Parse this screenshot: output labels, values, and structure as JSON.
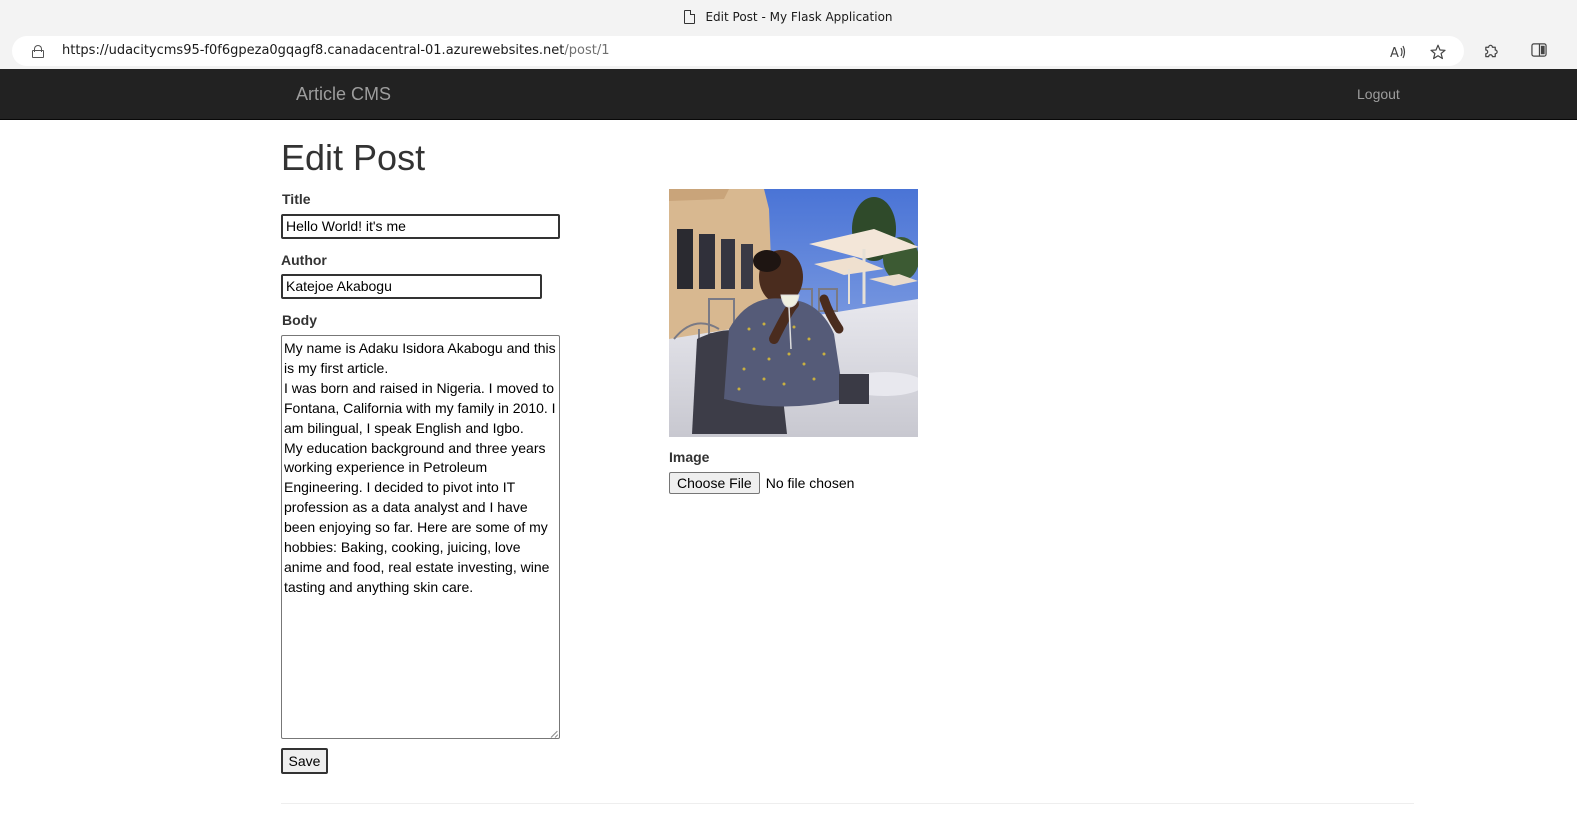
{
  "browser": {
    "tab_title": "Edit Post - My Flask Application",
    "url_host": "https://udacitycms95-f0f6gpeza0gqagf8.canadacentral-01.azurewebsites.net",
    "url_path": "/post/1"
  },
  "navbar": {
    "brand": "Article CMS",
    "logout": "Logout"
  },
  "form": {
    "heading": "Edit Post",
    "title_label": "Title",
    "title_value": "Hello World! it's me",
    "author_label": "Author",
    "author_value": "Katejoe Akabogu",
    "body_label": "Body",
    "body_value": "My name is Adaku Isidora Akabogu and this is my first article.\nI was born and raised in Nigeria. I moved to Fontana, California with my family in 2010. I am bilingual, I speak English and Igbo.\nMy education background and three years working experience in Petroleum Engineering. I decided to pivot into IT profession as a data analyst and I have been enjoying so far. Here are some of my hobbies: Baking, cooking, juicing, love anime and food, real estate investing, wine tasting and anything skin care.",
    "image_label": "Image",
    "choose_file": "Choose File",
    "file_status": "No file chosen",
    "save": "Save"
  },
  "icons": {
    "lock": "lock-icon",
    "read_aloud": "read-aloud-icon",
    "favorite": "star-icon",
    "extensions": "puzzle-icon",
    "split_screen": "split-screen-icon",
    "document": "document-icon"
  }
}
